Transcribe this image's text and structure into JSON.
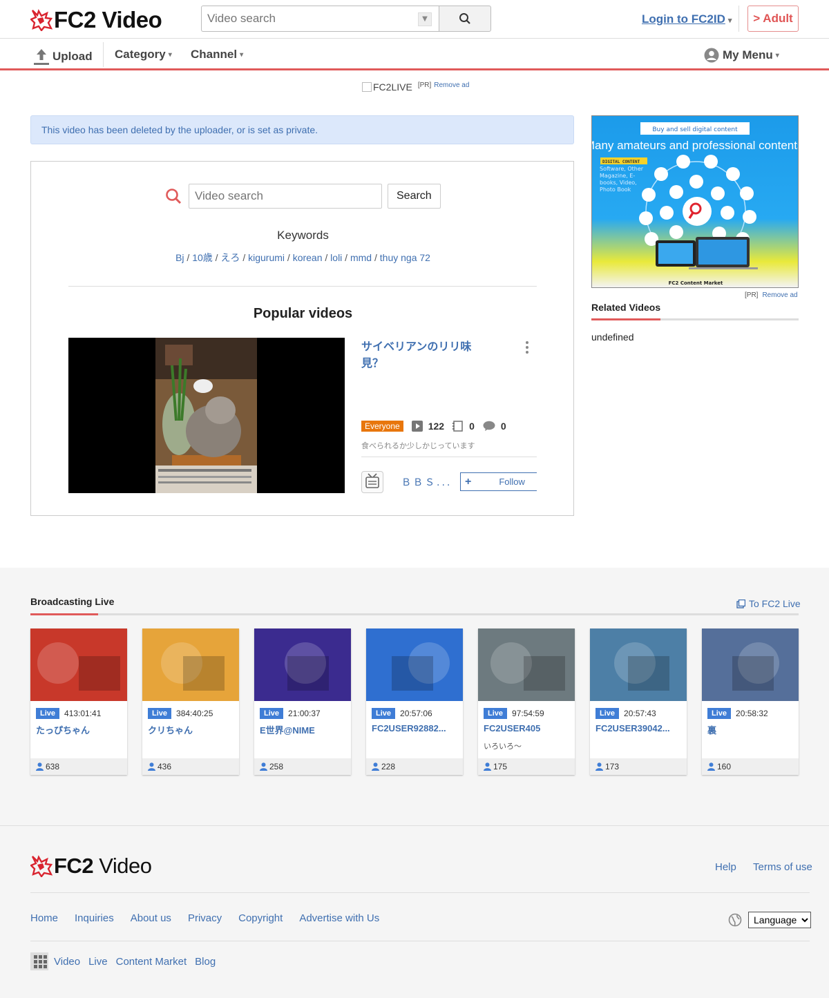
{
  "header": {
    "logo_text": "FC2",
    "logo_sub": "Video",
    "search_placeholder": "Video search",
    "login_label": "Login to FC2ID",
    "adult_label": "> Adult"
  },
  "nav": {
    "upload": "Upload",
    "category": "Category",
    "channel": "Channel",
    "my_menu": "My Menu"
  },
  "ad_top": {
    "img_alt": "FC2LIVE",
    "pr": "[PR]",
    "remove": "Remove ad"
  },
  "notice": "This video has been deleted by the uploader, or is set as private.",
  "panel": {
    "search_placeholder": "Video search",
    "search_button": "Search",
    "keywords_title": "Keywords",
    "keywords": [
      "Bj",
      "10歳",
      "えろ",
      "kigurumi",
      "korean",
      "loli",
      "mmd",
      "thuy nga 72"
    ],
    "popular_title": "Popular videos",
    "video": {
      "title": "サイベリアンのリリ味見？",
      "rating": "Everyone",
      "views": "122",
      "favorites": "0",
      "comments": "0",
      "description": "食べられるか少しかじっています",
      "uploader": "ＢＢＳ...",
      "follow": "Follow"
    }
  },
  "side": {
    "ad_tag": "Buy and sell digital content",
    "ad_headline": "Many amateurs and professional contents!",
    "ad_label": "DIGITAL CONTENT",
    "ad_list": "Software, Other Magazine, E-books, Video, Photo Book",
    "ad_footer": "FC2 Content Market",
    "pr": "[PR]",
    "remove": "Remove ad",
    "related_title": "Related Videos",
    "related_body": "undefined"
  },
  "live": {
    "title": "Broadcasting Live",
    "to_live": "To FC2 Live",
    "badge": "Live",
    "cards": [
      {
        "duration": "413:01:41",
        "name": "たっぴちゃん",
        "sub": "",
        "viewers": "638",
        "bg": "#c8382a"
      },
      {
        "duration": "384:40:25",
        "name": "クリちゃん",
        "sub": "",
        "viewers": "436",
        "bg": "#e6a43a"
      },
      {
        "duration": "21:00:37",
        "name": "E世界@NIME",
        "sub": "",
        "viewers": "258",
        "bg": "#3b2b8f"
      },
      {
        "duration": "20:57:06",
        "name": "FC2USER92882...",
        "sub": "",
        "viewers": "228",
        "bg": "#2f6fd0"
      },
      {
        "duration": "97:54:59",
        "name": "FC2USER405",
        "sub": "いろいろ〜",
        "viewers": "175",
        "bg": "#6d7a7f"
      },
      {
        "duration": "20:57:43",
        "name": "FC2USER39042...",
        "sub": "",
        "viewers": "173",
        "bg": "#4d7fa6"
      },
      {
        "duration": "20:58:32",
        "name": "裏",
        "sub": "",
        "viewers": "160",
        "bg": "#556f9a"
      }
    ]
  },
  "footer": {
    "logo_text": "FC2",
    "logo_sub": "Video",
    "help": "Help",
    "terms": "Terms of use",
    "links": [
      "Home",
      "Inquiries",
      "About us",
      "Privacy",
      "Copyright",
      "Advertise with Us"
    ],
    "language": "Language",
    "services": [
      "Video",
      "Live",
      "Content Market",
      "Blog"
    ]
  },
  "colors": {
    "accent_red": "#e05a5a",
    "link_blue": "#3f6fb0",
    "live_badge": "#3f7dd6",
    "everyone_badge": "#e8760c"
  }
}
